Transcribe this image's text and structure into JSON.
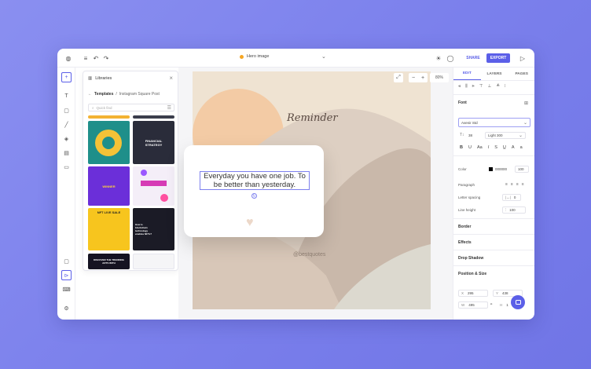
{
  "app": {
    "doc_title": "Hero image",
    "share_label": "SHARE",
    "export_label": "EXPORT"
  },
  "library": {
    "title": "Libraries",
    "breadcrumb_root": "Templates",
    "breadcrumb_sep": "/",
    "breadcrumb_current": "Instagram Square Post",
    "search_placeholder": "Quick find",
    "thumbs": [
      {
        "label": "",
        "bg": "#f3b233"
      },
      {
        "label": "",
        "bg": "#3a3d4c"
      },
      {
        "label": "",
        "bg": "#1f8f8a"
      },
      {
        "label": "FINANCIAL STRATEGY",
        "bg": "#2a2c3a"
      },
      {
        "label": "WINNER",
        "bg": "#6b2fd9"
      },
      {
        "label": "",
        "bg": "#f4eef8"
      },
      {
        "label": "NFT LIVE SALE",
        "bg": "#f7c51e"
      },
      {
        "label": "How is blockchain technology enables NFTs?",
        "bg": "#1b1b26"
      },
      {
        "label": "DISCOVER THE TRENDING ARTS WITH",
        "bg": "#151321"
      },
      {
        "label": "",
        "bg": "#f5f5f7"
      }
    ]
  },
  "canvas": {
    "zoom": "80%",
    "heading": "Reminder",
    "quote": "Everyday you have one job. To be better than yesterday.",
    "handle": "@bestquotes"
  },
  "panel": {
    "tabs": [
      "EDIT",
      "LAYERS",
      "PAGES"
    ],
    "font_label": "Font",
    "font_name": "Avenir Std",
    "font_size": "38",
    "font_weight": "Light 300",
    "color_label": "Color",
    "color_hex": "000000",
    "opacity": "100",
    "paragraph_label": "Paragraph",
    "letter_spacing_label": "Letter spacing",
    "letter_spacing": "0",
    "line_height_label": "Line height",
    "line_height": "100",
    "border_label": "Border",
    "effects_label": "Effects",
    "drop_shadow_label": "Drop Shadow",
    "position_label": "Position & Size",
    "x_label": "X",
    "x_value": "295",
    "y_label": "Y",
    "y_value": "438",
    "w_label": "W",
    "w_value": "495",
    "h_label": "H",
    "h_value": "1"
  },
  "colors": {
    "accent": "#5b5fe8",
    "bg": "#7b80ec"
  }
}
